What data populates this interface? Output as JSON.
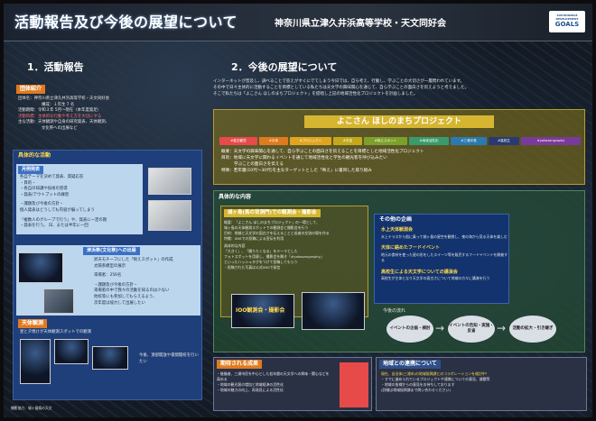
{
  "header": {
    "title": "活動報告及び今後の展望について",
    "school": "神奈川県立津久井浜高等学校・天文同好会",
    "sdg_top": "SUSTAINABLE DEVELOPMENT",
    "sdg_main": "GOALS"
  },
  "left": {
    "heading": "1．活動報告",
    "intro_label": "団体紹介",
    "intro_lines": [
      "団体名：神奈川県立津久井浜高等学校・天文同好会",
      "構成：１年生 7 名",
      "活動期間：令和３年 5月～現在（本年度発足）",
      "活動目標：主体的な行動や考え方を大切にする",
      "主な活動：天体観測や自身の研究発表、天体観測、",
      "文化祭への出展など"
    ],
    "activity_heading": "具体的な活動",
    "monthly_tab": "月例発表",
    "monthly_lines": [
      "各自テーマを決めて発表、質疑応答",
      "・目的・",
      "・各自の知識や技術の習得",
      "・発表/アウトプットの練習",
      "・課題及び今後の方針・",
      "個人発表はどうしても内容が偏ってしまう",
      "「複数人のグループで行う」や、発表に一定の期",
      "・発表を行う。 日、または半年に一回"
    ],
    "festival_tab": "津浜祭(文化祭)への出展",
    "festival_lines": [
      "昇天モチーフにした「映えスポット」の作成",
      "太陽系模型の展示",
      "来場者：256名",
      "・課題及び今後の方針・",
      "来場者の中で我々の活動を知るのは少ない",
      "他校等にも参加してもらえるよう、",
      "次年度は協力して出展したい"
    ],
    "observation_tab": "天体観測",
    "observation_line": "星と夕焼けが天体観測スポットでの観測",
    "observation_note": "今後、頂部開放や夜間開校を行いたい",
    "credit": "撮影協力：城ヶ島県の天文"
  },
  "right": {
    "heading": "2．今後の展望について",
    "intro": [
      "インターネットが普及し、調べることで答えがすぐにでてしまう今日では、自ら考え、行動し、学ぶことの大切さが一層問われています。",
      "その中で日々主体的に活動することを目標としている私たちは天文学の興味関心を通じて、自ら学ぶことの面白さを伝えようと考えました。",
      "そこで私たちは「よこさん ほしのまちプロジェクト」を提唱し上記の地域活性化プロジェクトを計画しました。"
    ],
    "project_title": "よこさん ほしのまちプロジェクト",
    "tags": [
      "#星空観賞",
      "#天体",
      "#プロジェクト",
      "#宇宙",
      "#映えスポット",
      "#地域活性化",
      "#三浦半島",
      "#高校生",
      "#yokosangraphy"
    ],
    "project_lines": [
      "概要：天文学の興味関心を通して、自ら学ぶことの面白さを伝えることを目標とした地域活性化プロジェクト",
      "目的：地域に天文学に関わるイベントを通じて地域活性化と学生の観光客を呼び込みたい",
      "学ぶことの面白さを伝える",
      "特徴：若年層(10代～30代)を主なターゲットとした「映え」に着目した取り組み"
    ],
    "detail_heading": "具体的な内容",
    "detail_tab": "城ヶ島(馬の背洞門)での観測会・撮影会",
    "detail_lines": [
      "概要：「よこさん ほしのまちプロジェクト」の一環として、",
      "城ヶ島の天体観測スポットでの観測会と撮影会を行う",
      "目的：地域と天文学の面白さを伝えることと若者の交流の場を作る",
      "特徴：SNSでの投稿による宣伝を利用",
      "具体的な内容",
      "「大きく」、「撮りたくなる」をテーマとした",
      "フォトスポットを用意し、撮影会を開き「#yokosangraphy」",
      "といったハッシュタグをつけて投稿してもらう",
      "・投稿された写真は公式SNSで発信"
    ],
    "event_poster_title": "IOO観測会・撮影会",
    "other_heading": "その他の企画",
    "other_items": [
      {
        "title": "水上天体観測会",
        "text": "水上テラスから船に乗って城ヶ島の星空を観賞し、夜の海から見る天体を楽しむ"
      },
      {
        "title": "天体に絡めたフードイベント",
        "text": "地元の食材を使った星の形をしたスイーツ等を販売するフードイベントを開催する"
      },
      {
        "title": "高校生による天文学についての講演会",
        "text": "高校生が主体となり天文学の面白さについて地域の方々に講演を行う"
      }
    ],
    "flow_label": "今後の流れ",
    "flow": [
      "イベントの企画・検討",
      "イベントの告知・実施・反省",
      "活動の拡大・引き継ぎ"
    ],
    "expected_heading": "期待される成果",
    "expected_lines": [
      "・後継者、三浦市民を中心とした若年層の天文学への興味・関心などを高める",
      "・地域の観光客の増加と地域経済の活性化",
      "・地域の魅力の向上、再発見による活性化"
    ],
    "collab_heading": "地域との連携について",
    "collab_lines": [
      "現在、自治体(三浦市)の地域振興課とのコラボレーションを検討中！",
      "・すでに進められているプロジェクトや連携についての意見、課題等",
      "・地域の皆様からの意見をお待ちしております",
      "(詳細は地域振興課まで問い合わせください)"
    ]
  },
  "colors": {
    "accent": "#e07a1f",
    "gold": "#d6b530",
    "blue": "#3b70c5",
    "red": "#e84a4a"
  }
}
